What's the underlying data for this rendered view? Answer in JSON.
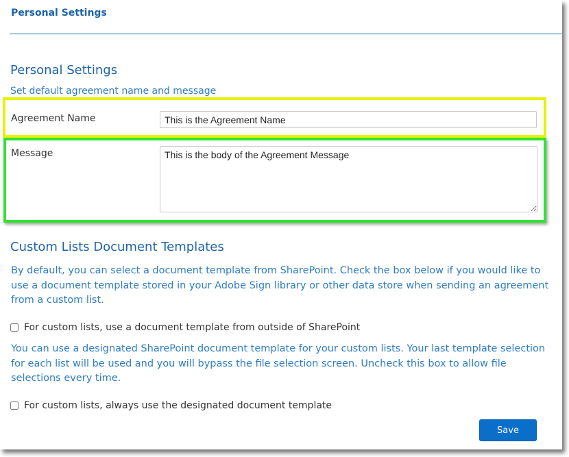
{
  "header": {
    "title": "Personal Settings"
  },
  "personal_settings": {
    "title": "Personal Settings",
    "subtitle": "Set default agreement name and message",
    "agreement_name": {
      "label": "Agreement Name",
      "value": "This is the Agreement Name"
    },
    "message": {
      "label": "Message",
      "value": "This is the body of the Agreement Message"
    }
  },
  "custom_lists": {
    "title": "Custom Lists Document Templates",
    "description": "By default, you can select a document template from SharePoint. Check the box below if you would like to use a document template stored in your Adobe Sign library or other data store when sending an agreement from a custom list.",
    "checkbox_outside": {
      "label": "For custom lists, use a document template from outside of SharePoint",
      "checked": false
    },
    "description2": "You can use a designated SharePoint document template for your custom lists. Your last template selection for each list will be used and you will bypass the file selection screen. Uncheck this box to allow file selections every time.",
    "checkbox_designated": {
      "label": "For custom lists, always use the designated document template",
      "checked": false
    }
  },
  "actions": {
    "save_label": "Save"
  },
  "colors": {
    "accent": "#1e64a8",
    "link_text": "#2f7cc2",
    "highlight_yellow": "#e6f20a",
    "highlight_green": "#33e233",
    "save_button": "#0b6fc9"
  }
}
